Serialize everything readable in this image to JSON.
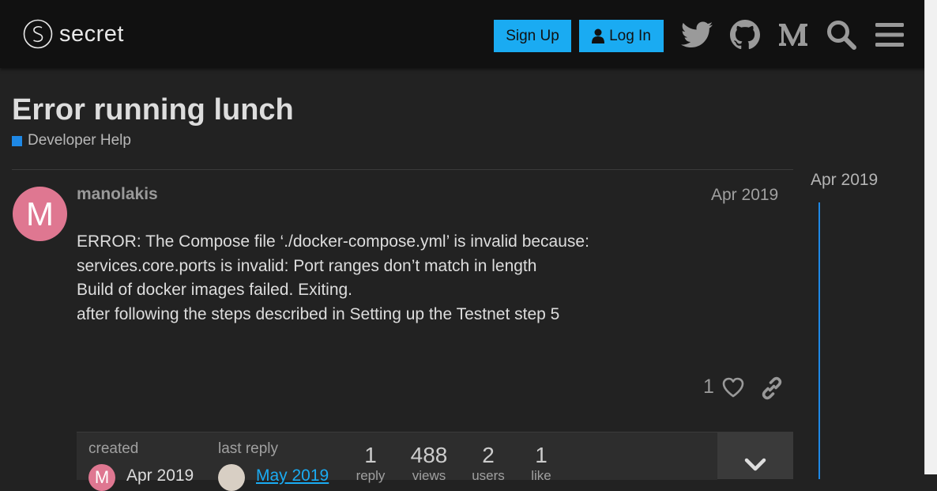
{
  "header": {
    "logo_text": "secret",
    "signup_label": "Sign Up",
    "login_label": "Log In",
    "icons": [
      "twitter-icon",
      "github-icon",
      "medium-icon",
      "search-icon",
      "hamburger-menu-icon"
    ]
  },
  "topic": {
    "title": "Error running lunch",
    "category": "Developer Help",
    "category_color": "#1e88e5"
  },
  "post": {
    "avatar_letter": "M",
    "avatar_color": "#df7791",
    "username": "manolakis",
    "date": "Apr 2019",
    "lines": [
      "ERROR: The Compose file ‘./docker-compose.yml’ is invalid because:",
      "services.core.ports is invalid: Port ranges don’t match in length",
      "Build of docker images failed. Exiting.",
      "after following the steps described in Setting up the Testnet step 5"
    ],
    "like_count": "1"
  },
  "topic_map": {
    "created_label": "created",
    "created_date": "Apr 2019",
    "last_reply_label": "last reply",
    "last_reply_date": "May 2019",
    "stats": [
      {
        "num": "1",
        "label": "reply"
      },
      {
        "num": "488",
        "label": "views"
      },
      {
        "num": "2",
        "label": "users"
      },
      {
        "num": "1",
        "label": "like"
      }
    ]
  },
  "timeline": {
    "date": "Apr 2019"
  },
  "colors": {
    "accent": "#1aabf2",
    "background": "#222222",
    "header": "#111111"
  }
}
